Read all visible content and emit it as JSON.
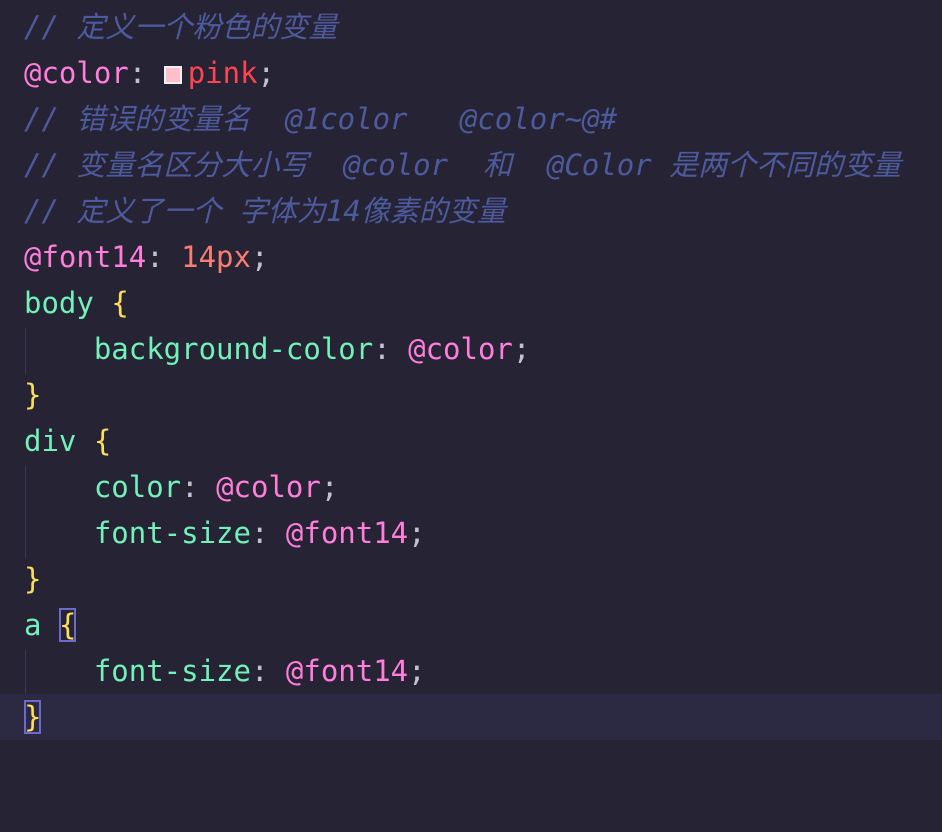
{
  "colors": {
    "background": "#262335",
    "comment": "#4d5a9c",
    "variable": "#ff7edb",
    "string": "#fe4450",
    "number": "#f97e72",
    "selector": "#72f1b8",
    "brace": "#fede5d",
    "swatch": "#ffc0cb"
  },
  "code": {
    "line1": {
      "comment": "// 定义一个粉色的变量"
    },
    "line2": {
      "var": "@color",
      "colon": ": ",
      "value": "pink",
      "semi": ";"
    },
    "line3": {
      "comment": "// 错误的变量名  @1color   @color~@#"
    },
    "line4": {
      "comment": "// 变量名区分大小写  @color  和  @Color 是两个不同的变量"
    },
    "line5": {
      "comment": "// 定义了一个 字体为14像素的变量"
    },
    "line6": {
      "var": "@font14",
      "colon": ": ",
      "value": "14px",
      "semi": ";"
    },
    "line7": {
      "selector": "body",
      "space": " ",
      "brace": "{"
    },
    "line8": {
      "indent": "    ",
      "prop": "background-color",
      "colon": ": ",
      "value": "@color",
      "semi": ";"
    },
    "line9": {
      "brace": "}"
    },
    "line10": {
      "selector": "div",
      "space": " ",
      "brace": "{"
    },
    "line11": {
      "indent": "    ",
      "prop": "color",
      "colon": ": ",
      "value": "@color",
      "semi": ";"
    },
    "line12": {
      "indent": "    ",
      "prop": "font-size",
      "colon": ": ",
      "value": "@font14",
      "semi": ";"
    },
    "line13": {
      "brace": "}"
    },
    "line14": {
      "selector": "a",
      "space": " ",
      "brace": "{"
    },
    "line15": {
      "indent": "    ",
      "prop": "font-size",
      "colon": ": ",
      "value": "@font14",
      "semi": ";"
    },
    "line16": {
      "brace": "}"
    }
  }
}
